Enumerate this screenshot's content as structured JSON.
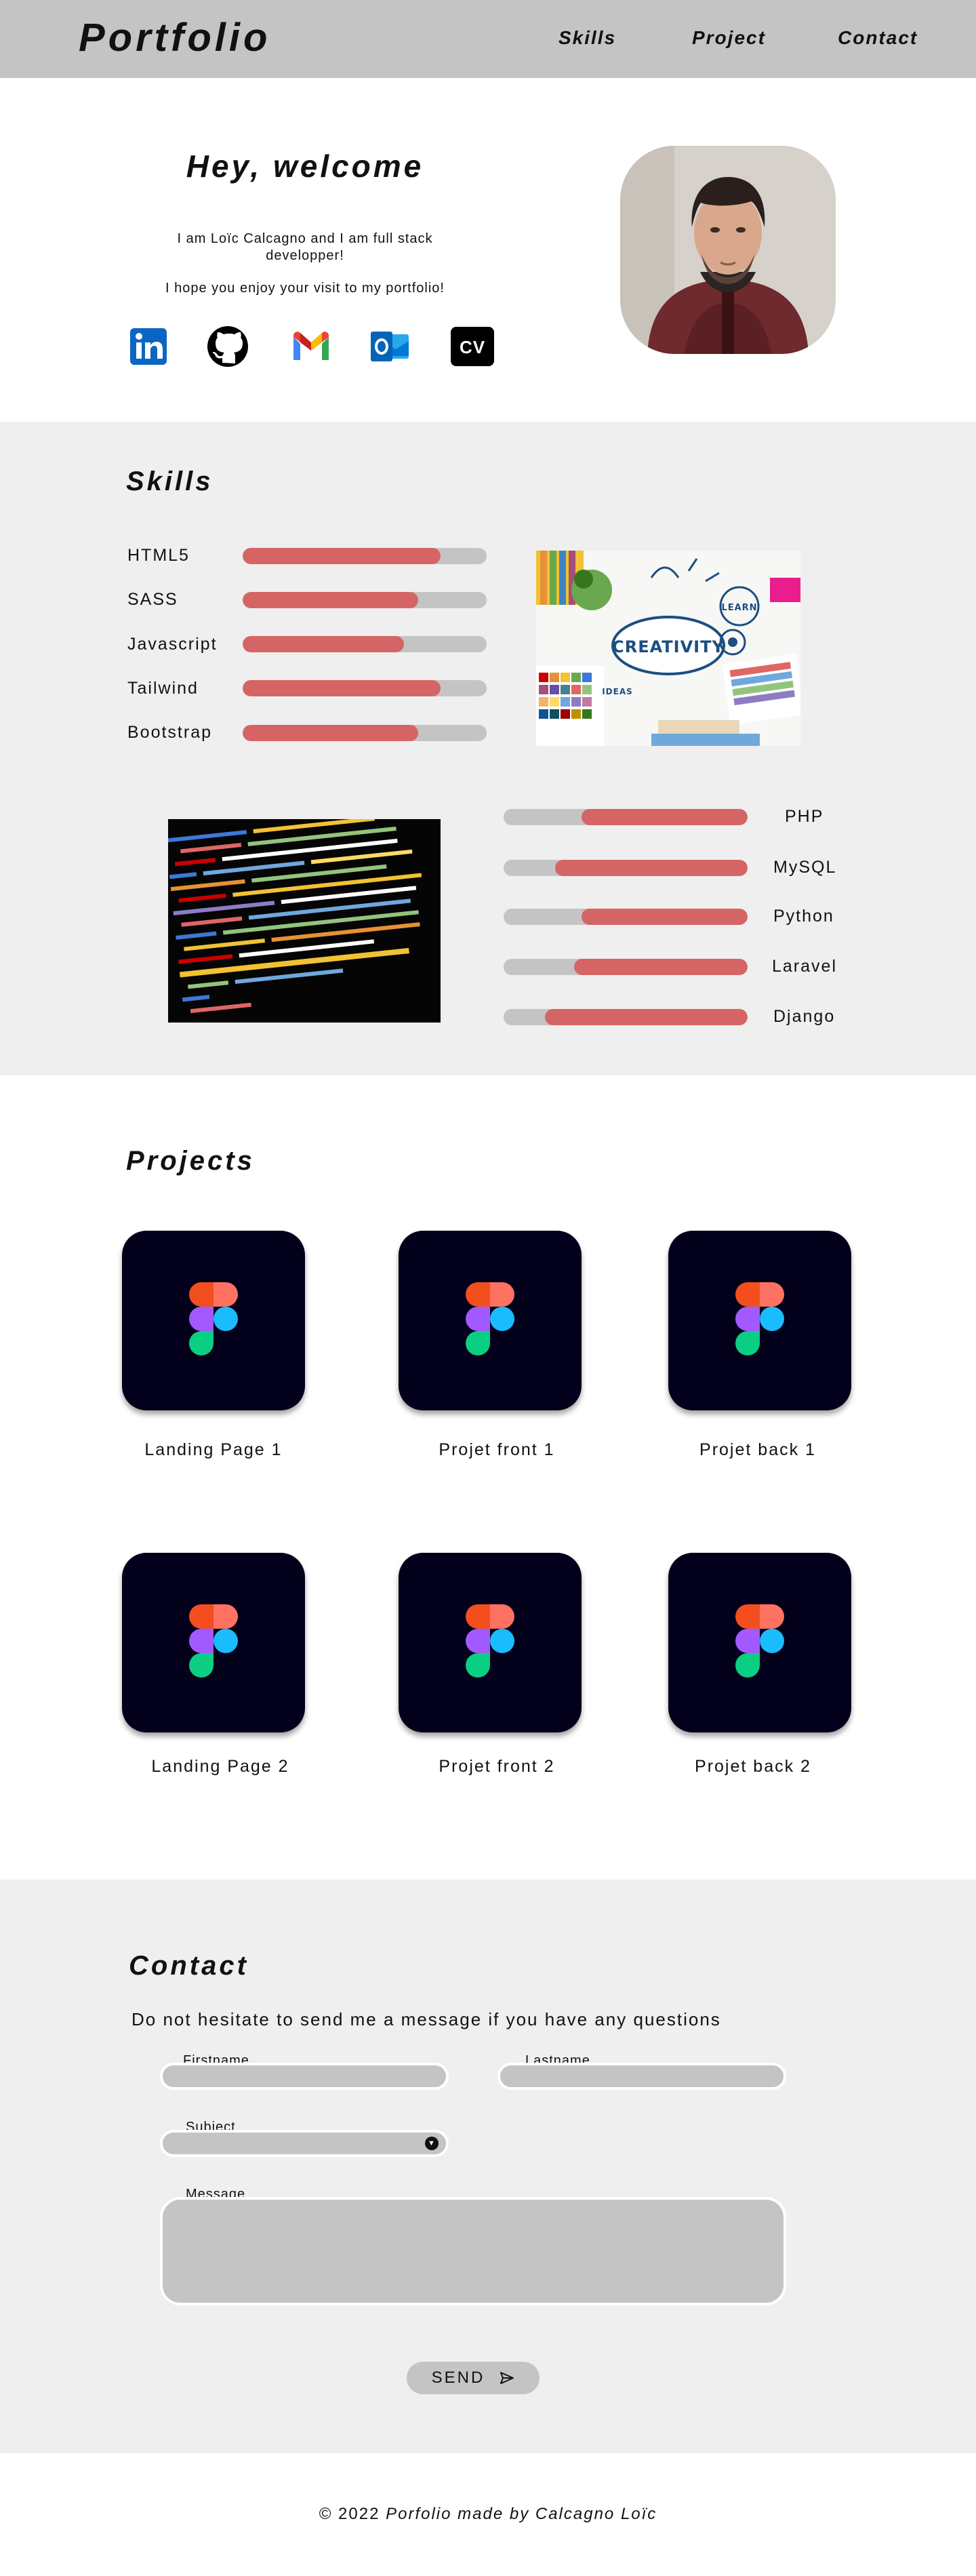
{
  "header": {
    "logo": "Portfolio",
    "nav": [
      "Skills",
      "Project",
      "Contact"
    ],
    "background": "#c4c4c4"
  },
  "hero": {
    "title": "Hey, welcome",
    "intro": "I am Loïc Calcagno and I am full stack developper!",
    "wish": "I hope you enjoy your visit to my portfolio!",
    "socials": [
      "linkedin-icon",
      "github-icon",
      "gmail-icon",
      "outlook-icon",
      "cv-icon"
    ],
    "cv_label": "CV"
  },
  "skills": {
    "title": "Skills",
    "front": [
      {
        "name": "HTML5",
        "level": 0.81
      },
      {
        "name": "SASS",
        "level": 0.72
      },
      {
        "name": "Javascript",
        "level": 0.66
      },
      {
        "name": "Tailwind",
        "level": 0.81
      },
      {
        "name": "Bootstrap",
        "level": 0.72
      }
    ],
    "back": [
      {
        "name": "PHP",
        "level": 0.68
      },
      {
        "name": "MySQL",
        "level": 0.79
      },
      {
        "name": "Python",
        "level": 0.68
      },
      {
        "name": "Laravel",
        "level": 0.71
      },
      {
        "name": "Django",
        "level": 0.83
      }
    ],
    "creativity_words": [
      "CREATIVITY",
      "LEARN",
      "IDEAS"
    ],
    "bar_fill_color": "#d56565",
    "bar_track_color": "#c4c4c4",
    "background": "#efefef"
  },
  "projects": {
    "title": "Projects",
    "items": [
      "Landing Page 1",
      "Projet front 1",
      "Projet back 1",
      "Landing Page 2",
      "Projet front 2",
      "Projet back 2"
    ],
    "card_color": "#03001c"
  },
  "contact": {
    "title": "Contact",
    "text": "Do not hesitate to send me a message if you have any questions",
    "firstname_label": "Firstname",
    "lastname_label": "Lastname",
    "subject_label": "Subject",
    "message_label": "Message",
    "send_label": "SEND"
  },
  "footer": {
    "prefix": "© 2022",
    "text": "Porfolio made by Calcagno Loïc"
  }
}
